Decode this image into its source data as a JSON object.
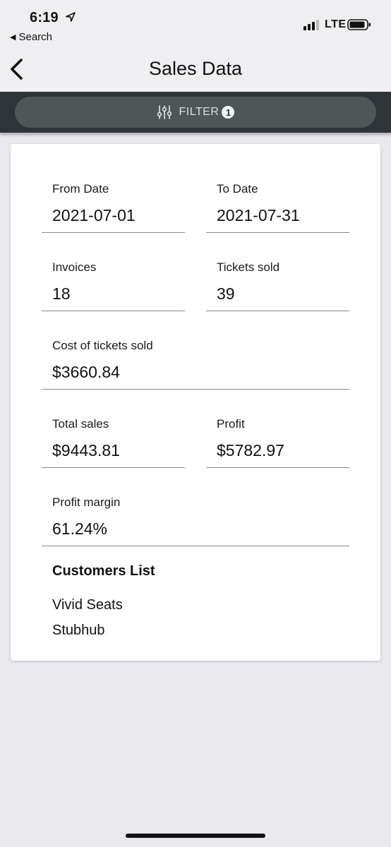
{
  "status_bar": {
    "time": "6:19",
    "back_app_label": "Search",
    "network": "LTE"
  },
  "nav": {
    "title": "Sales Data"
  },
  "filter": {
    "label": "FILTER",
    "count": "1"
  },
  "fields": {
    "from_date": {
      "label": "From Date",
      "value": "2021-07-01"
    },
    "to_date": {
      "label": "To Date",
      "value": "2021-07-31"
    },
    "invoices": {
      "label": "Invoices",
      "value": "18"
    },
    "tickets_sold": {
      "label": "Tickets sold",
      "value": "39"
    },
    "cost": {
      "label": "Cost of tickets sold",
      "value": "$3660.84"
    },
    "total_sales": {
      "label": "Total sales",
      "value": "$9443.81"
    },
    "profit": {
      "label": "Profit",
      "value": "$5782.97"
    },
    "profit_margin": {
      "label": "Profit margin",
      "value": "61.24%"
    }
  },
  "customers": {
    "title": "Customers List",
    "items": [
      "Vivid Seats",
      "Stubhub"
    ]
  },
  "colors": {
    "filter_bar_bg": "#2f3438",
    "filter_pill_bg": "#505558",
    "page_bg": "#e9e8ed"
  }
}
